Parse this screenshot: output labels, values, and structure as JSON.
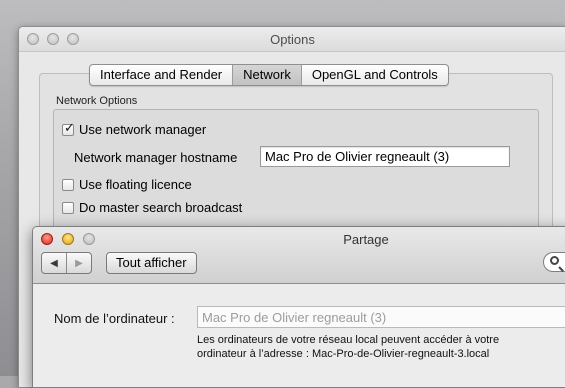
{
  "options_window": {
    "title": "Options",
    "tabs": [
      {
        "label": "Interface and Render",
        "selected": false
      },
      {
        "label": "Network",
        "selected": true
      },
      {
        "label": "OpenGL and Controls",
        "selected": false
      }
    ],
    "group_title": "Network Options",
    "use_network_manager": {
      "label": "Use network manager",
      "checked": true
    },
    "hostname_label": "Network manager hostname",
    "hostname_value": "Mac Pro de Olivier regneault (3)",
    "use_floating_licence": {
      "label": "Use floating licence",
      "checked": false
    },
    "master_search_broadcast": {
      "label": "Do master search broadcast",
      "checked": false
    }
  },
  "partage_window": {
    "title": "Partage",
    "back_icon": "◀",
    "forward_icon": "▶",
    "show_all_label": "Tout afficher",
    "search_icon": "magnifier-icon",
    "computer_name_label": "Nom de l’ordinateur :",
    "computer_name_value": "Mac Pro de Olivier regneault (3)",
    "description_line1": "Les ordinateurs de votre réseau local peuvent accéder à votre",
    "description_line2": "ordinateur à l’adresse : Mac-Pro-de-Olivier-regneault-3.local"
  },
  "colors": {
    "close_button": "#d9281b",
    "minimize_button": "#e0a414",
    "inactive_button": "#bfbfbf"
  }
}
